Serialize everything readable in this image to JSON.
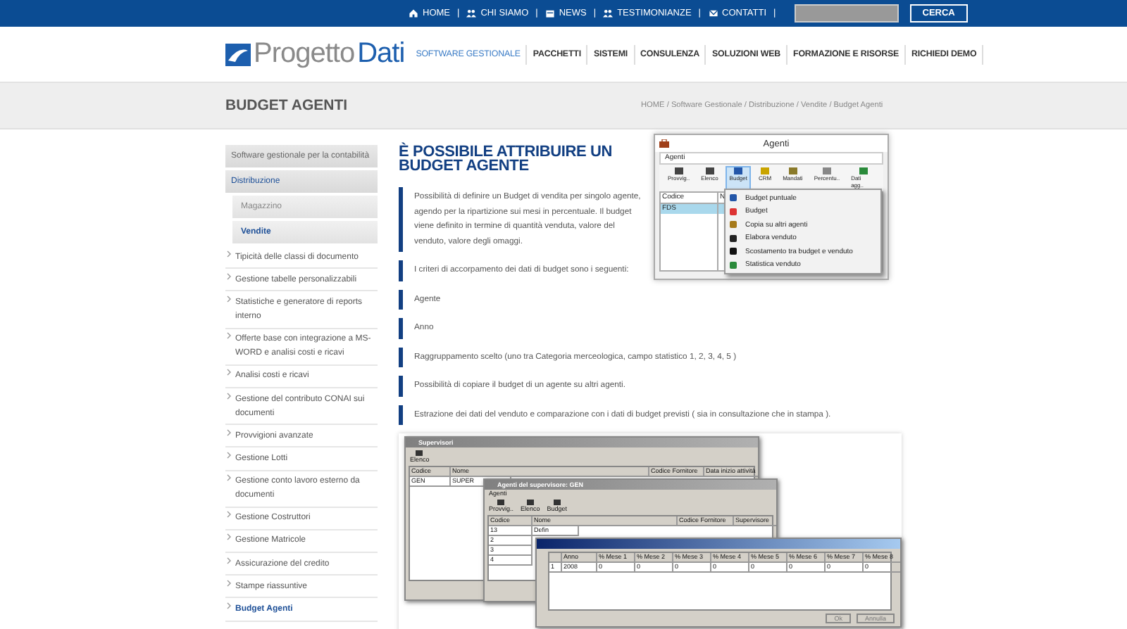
{
  "top_bar": {
    "links": [
      {
        "label": "HOME",
        "separator": "|"
      },
      {
        "label": "CHI SIAMO",
        "separator": "|"
      },
      {
        "label": "NEWS",
        "separator": "|"
      },
      {
        "label": "TESTIMONIANZE",
        "separator": "|"
      },
      {
        "label": "CONTATTI",
        "separator": "|"
      }
    ],
    "search_button": "CERCA"
  },
  "header": {
    "logo": {
      "part_1": "Progetto",
      "part_2": "Dati"
    },
    "nav": [
      {
        "label": "SOFTWARE GESTIONALE",
        "selected": true
      },
      {
        "label": "PACCHETTI",
        "selected": false
      },
      {
        "label": "SISTEMI",
        "selected": false
      },
      {
        "label": "CONSULENZA",
        "selected": false
      },
      {
        "label": "SOLUZIONI WEB",
        "selected": false
      },
      {
        "label": "FORMAZIONE E RISORSE",
        "selected": false
      },
      {
        "label": "RICHIEDI DEMO",
        "selected": false
      }
    ]
  },
  "page_title": "BUDGET AGENTI",
  "breadcrumb": "HOME / Software Gestionale / Distribuzione / Vendite / Budget Agenti",
  "sidebar": {
    "categories": [
      {
        "label": "Software gestionale per la contabilità",
        "kind": "category",
        "selected": false
      },
      {
        "label": "Distribuzione",
        "kind": "category",
        "selected": true
      },
      {
        "label": "Magazzino",
        "kind": "subcategory",
        "selected": false
      },
      {
        "label": "Vendite",
        "kind": "subcategory",
        "selected": true
      }
    ],
    "items": [
      {
        "label": "Tipicità delle classi di documento",
        "selected": false
      },
      {
        "label": "Gestione tabelle personalizzabili",
        "selected": false
      },
      {
        "label": "Statistiche e generatore di reports interno",
        "selected": false
      },
      {
        "label": "Offerte base con integrazione a MS-WORD e analisi costi e ricavi",
        "selected": false
      },
      {
        "label": "Analisi costi e ricavi",
        "selected": false
      },
      {
        "label": "Gestione del contributo CONAI sui documenti",
        "selected": false
      },
      {
        "label": "Provvigioni avanzate",
        "selected": false
      },
      {
        "label": "Gestione Lotti",
        "selected": false
      },
      {
        "label": "Gestione conto lavoro esterno da documenti",
        "selected": false
      },
      {
        "label": "Gestione Costruttori",
        "selected": false
      },
      {
        "label": "Gestione Matricole",
        "selected": false
      },
      {
        "label": "Assicurazione del credito",
        "selected": false
      },
      {
        "label": "Stampe riassuntive",
        "selected": false
      },
      {
        "label": "Budget Agenti",
        "selected": true
      }
    ]
  },
  "article": {
    "heading": "È POSSIBILE ATTRIBUIRE UN BUDGET AGENTE",
    "paragraphs": [
      "Possibilità di definire un Budget di vendita per singolo agente, agendo  per la ripartizione sui mesi in percentuale. Il budget viene definito in termine di quantità  venduta, valore del venduto,  valore degli omaggi.",
      "I criteri di accorpamento dei dati di budget sono i seguenti:",
      "Agente",
      "Anno",
      "Raggruppamento scelto (uno tra Categoria merceologica, campo statistico 1, 2, 3, 4, 5 )",
      "Possibilità di copiare  il budget di un agente su altri agenti.",
      "Estrazione dei dati del venduto  e comparazione con i dati di budget previsti ( sia in consultazione che in stampa )."
    ]
  },
  "agenti_window": {
    "title": "Agenti",
    "menu": "Agenti",
    "toolbar": [
      {
        "label": "Provvig..",
        "selected": false
      },
      {
        "label": "Elenco",
        "selected": false
      },
      {
        "label": "Budget",
        "selected": true
      },
      {
        "label": "CRM",
        "selected": false
      },
      {
        "label": "Mandati",
        "selected": false
      },
      {
        "label": "Percentu..",
        "selected": false
      },
      {
        "label": "Dati agg..",
        "selected": false
      }
    ],
    "columns": [
      "Codice",
      "N"
    ],
    "row": [
      "FDS"
    ],
    "dropdown": [
      "Budget puntuale",
      "Budget",
      "Copia su altri agenti",
      "Elabora venduto",
      "Scostamento tra budget e venduto",
      "Statistica venduto"
    ]
  },
  "supervisori_window": {
    "title": "Supervisori",
    "toolbar": [
      "Elenco"
    ],
    "columns": [
      "Codice",
      "Nome",
      "Codice Fornitore",
      "Data inizio attività"
    ],
    "row": [
      "GEN",
      "SUPER"
    ]
  },
  "agenti_supervisore_window": {
    "title": "Agenti del supervisore: GEN",
    "menu": "Agenti",
    "toolbar": [
      "Provvig..",
      "Elenco",
      "Budget"
    ],
    "columns": [
      "Codice",
      "Nome",
      "Codice Fornitore",
      "Supervisore"
    ],
    "rows": [
      [
        "13",
        "Defin"
      ],
      [
        "2"
      ],
      [
        "3"
      ],
      [
        "4"
      ]
    ]
  },
  "budget_window": {
    "columns": [
      "Anno",
      "% Mese 1",
      "% Mese 2",
      "% Mese 3",
      "% Mese 4",
      "% Mese 5",
      "% Mese 6",
      "% Mese 7",
      "% Mese 8"
    ],
    "row_number": "1",
    "row": [
      "2008",
      "0",
      "0",
      "0",
      "0",
      "0",
      "0",
      "0",
      "0"
    ],
    "buttons": [
      "Ok",
      "Annulla"
    ]
  }
}
